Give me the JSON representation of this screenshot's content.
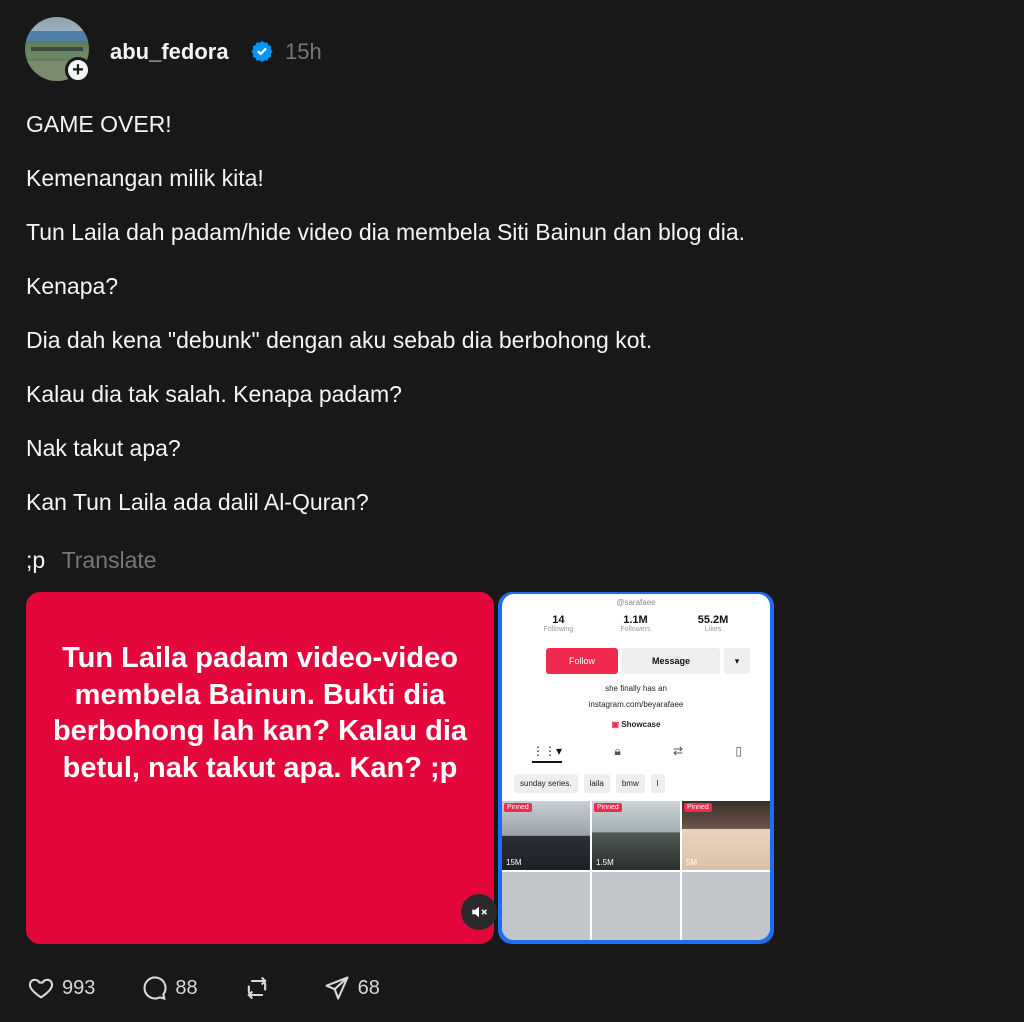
{
  "post": {
    "username": "abu_fedora",
    "time": "15h",
    "lines": [
      "GAME OVER!",
      "Kemenangan milik kita!",
      "Tun Laila dah padam/hide video dia membela Siti Bainun dan blog dia.",
      "Kenapa?",
      "Dia dah kena \"debunk\" dengan aku sebab dia berbohong kot.",
      "Kalau dia tak salah. Kenapa padam?",
      "Nak takut apa?",
      "Kan Tun Laila ada dalil Al-Quran?"
    ],
    "last_line": ";p",
    "translate_label": "Translate"
  },
  "media": {
    "red_card_text": "Tun Laila padam video-video membela Bainun. Bukti dia berbohong lah kan? Kalau dia betul, nak takut apa. Kan? ;p",
    "phone": {
      "handle": "@sarafaee",
      "stats": [
        {
          "num": "14",
          "label": "Following"
        },
        {
          "num": "1.1M",
          "label": "Followers"
        },
        {
          "num": "55.2M",
          "label": "Likes"
        }
      ],
      "follow_label": "Follow",
      "message_label": "Message",
      "more_label": "▾",
      "bio": "she finally has an",
      "link": "instagram.com/beyarafaee",
      "showcase": "Showcase",
      "chips": [
        "sunday series.",
        "laila",
        "bmw",
        "l"
      ],
      "thumbs": [
        {
          "pinned": "Pinned",
          "views": "15M"
        },
        {
          "pinned": "Pinned",
          "views": "1.5M"
        },
        {
          "pinned": "Pinned",
          "views": "5M"
        }
      ]
    }
  },
  "actions": {
    "likes": "993",
    "replies": "88",
    "reposts": "",
    "shares": "68"
  },
  "colors": {
    "background": "#181818",
    "red_card": "#e3073c",
    "verified": "#0095f6",
    "muted_text": "#777777"
  }
}
